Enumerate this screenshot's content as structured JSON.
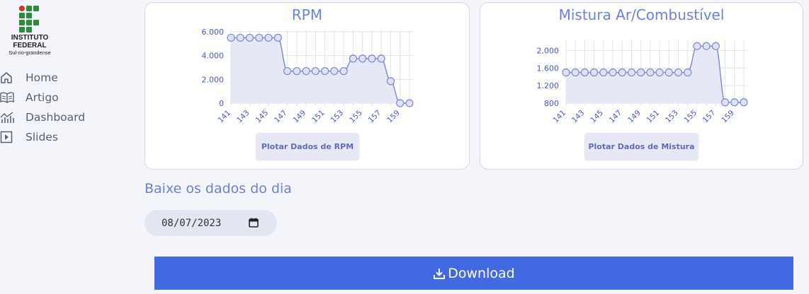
{
  "logo": {
    "line1": "INSTITUTO",
    "line2": "FEDERAL",
    "line3": "Sul-rio-grandense"
  },
  "nav": [
    {
      "label": "Home",
      "icon": "home-icon"
    },
    {
      "label": "Artigo",
      "icon": "book-icon"
    },
    {
      "label": "Dashboard",
      "icon": "chart-icon"
    },
    {
      "label": "Slides",
      "icon": "play-icon"
    }
  ],
  "cards": [
    {
      "title": "RPM",
      "button": "Plotar Dados de RPM"
    },
    {
      "title": "Mistura Ar/Combustível",
      "button": "Plotar Dados de Mistura"
    }
  ],
  "chart_data": [
    {
      "type": "area",
      "title": "RPM",
      "x": [
        141,
        142,
        143,
        144,
        145,
        146,
        147,
        148,
        149,
        150,
        151,
        152,
        153,
        154,
        155,
        156,
        157,
        158,
        159,
        160
      ],
      "x_tick_labels": [
        "141",
        "143",
        "145",
        "147",
        "149",
        "151",
        "153",
        "155",
        "157",
        "159"
      ],
      "values": [
        5500,
        5500,
        5500,
        5500,
        5500,
        5500,
        2700,
        2700,
        2700,
        2700,
        2700,
        2700,
        2700,
        3750,
        3750,
        3750,
        3750,
        1850,
        0,
        0
      ],
      "y_ticks": [
        "0",
        "2.000",
        "4.000",
        "6.000"
      ],
      "ylim": [
        0,
        6000
      ],
      "color": "#7d86d8",
      "fill": "#e6e8f6",
      "grid": true
    },
    {
      "type": "area",
      "title": "Mistura Ar/Combustível",
      "x": [
        141,
        142,
        143,
        144,
        145,
        146,
        147,
        148,
        149,
        150,
        151,
        152,
        153,
        154,
        155,
        156,
        157,
        158,
        159,
        160
      ],
      "x_tick_labels": [
        "141",
        "143",
        "145",
        "147",
        "149",
        "151",
        "153",
        "155",
        "157",
        "159"
      ],
      "values": [
        1500,
        1500,
        1500,
        1500,
        1500,
        1500,
        1500,
        1500,
        1500,
        1500,
        1500,
        1500,
        1500,
        1500,
        2100,
        2100,
        2100,
        820,
        820,
        820
      ],
      "y_ticks": [
        "800",
        "1.200",
        "1.600",
        "2.000"
      ],
      "ylim": [
        800,
        2200
      ],
      "color": "#7d86d8",
      "fill": "#e6e8f6",
      "grid": true
    }
  ],
  "download_section": {
    "title": "Baixe os dados do dia",
    "date_value": "08/07/2023",
    "download_label": "Download"
  },
  "colors": {
    "accent": "#4169e1",
    "title": "#6d7fe0"
  }
}
